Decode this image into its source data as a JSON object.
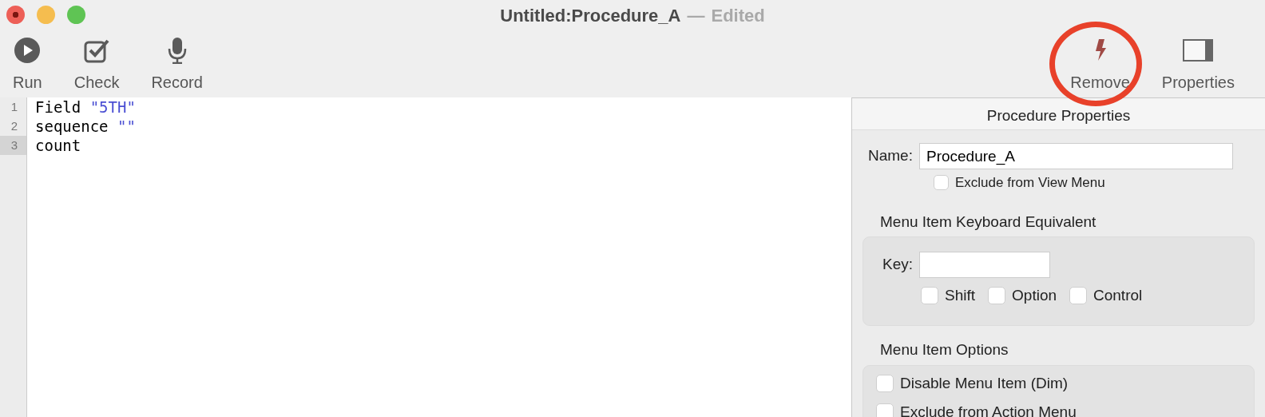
{
  "window": {
    "title": "Untitled:Procedure_A",
    "separator": "—",
    "status": "Edited"
  },
  "toolbar_left": [
    {
      "label": "Run"
    },
    {
      "label": "Check"
    },
    {
      "label": "Record"
    }
  ],
  "toolbar_right": [
    {
      "label": "Remove",
      "highlighted": true
    },
    {
      "label": "Properties",
      "highlighted": false
    }
  ],
  "editor": {
    "lines": [
      {
        "number": "1",
        "current": false,
        "tokens": [
          {
            "text": "Field ",
            "kind": "plain"
          },
          {
            "text": "\"5TH\"",
            "kind": "string"
          }
        ]
      },
      {
        "number": "2",
        "current": false,
        "tokens": [
          {
            "text": "sequence ",
            "kind": "plain"
          },
          {
            "text": "\"\"",
            "kind": "string"
          }
        ]
      },
      {
        "number": "3",
        "current": true,
        "tokens": [
          {
            "text": "count",
            "kind": "plain"
          }
        ]
      }
    ]
  },
  "properties": {
    "title": "Procedure Properties",
    "name_label": "Name:",
    "name_value": "Procedure_A",
    "exclude_view": {
      "label": "Exclude from View Menu",
      "checked": false
    },
    "keyboard": {
      "title": "Menu Item Keyboard Equivalent",
      "key_label": "Key:",
      "modifiers": [
        {
          "label": "Shift",
          "checked": false
        },
        {
          "label": "Option",
          "checked": false
        },
        {
          "label": "Control",
          "checked": false
        }
      ]
    },
    "options": {
      "title": "Menu Item Options",
      "items": [
        {
          "label": "Disable Menu Item (Dim)",
          "checked": false
        },
        {
          "label": "Exclude from Action Menu",
          "checked": false
        }
      ]
    }
  }
}
